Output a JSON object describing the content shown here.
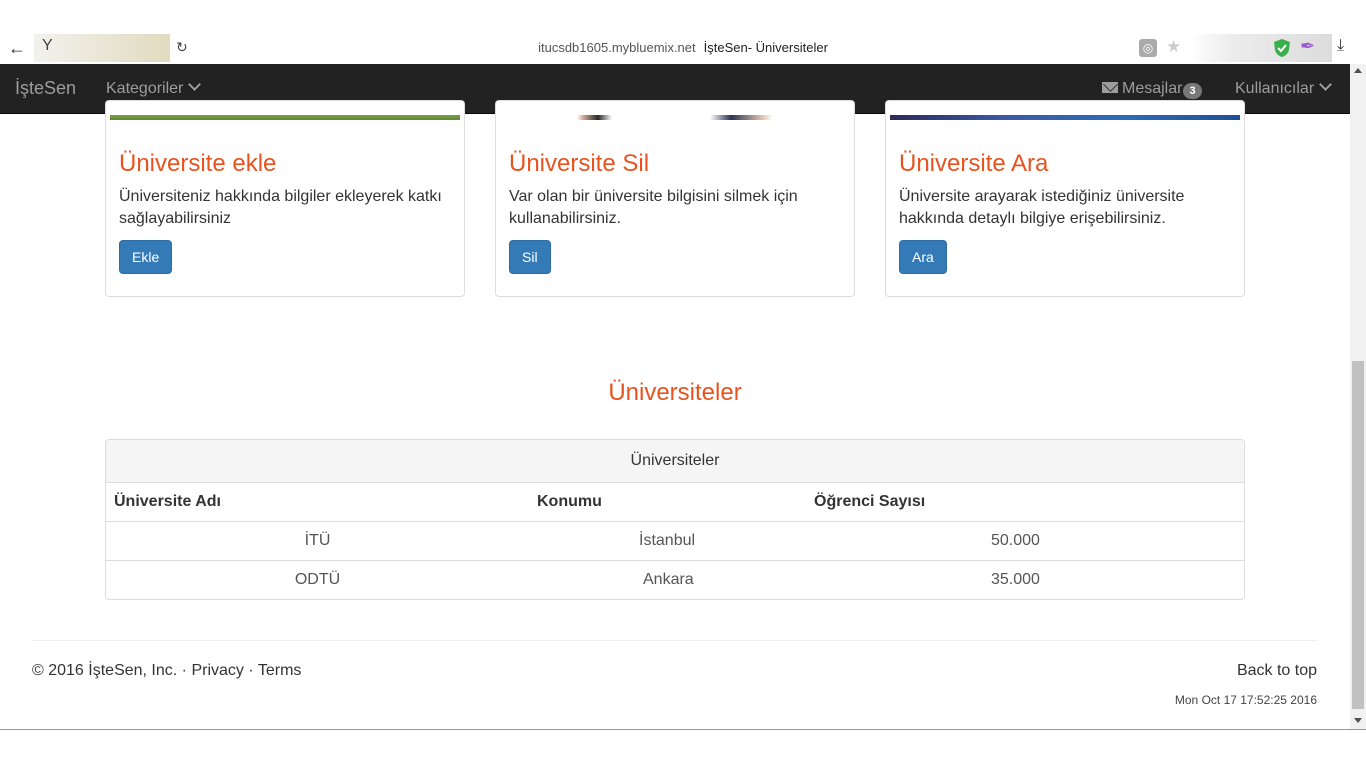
{
  "browser": {
    "omni_char": "Y",
    "url_host": "itucsdb1605.mybluemix.net",
    "page_title": "İşteSen- Üniversiteler"
  },
  "navbar": {
    "brand": "İşteSen",
    "categories": "Kategoriler",
    "messages": "Mesajlar",
    "messages_count": "3",
    "users": "Kullanıcılar"
  },
  "cards": [
    {
      "title": "Üniversite ekle",
      "text": "Üniversiteniz hakkında bilgiler ekleyerek katkı sağlayabilirsiniz",
      "button": "Ekle"
    },
    {
      "title": "Üniversite Sil",
      "text": "Var olan bir üniversite bilgisini silmek için kullanabilirsiniz.",
      "button": "Sil"
    },
    {
      "title": "Üniversite Ara",
      "text": "Üniversite arayarak istediğiniz üniversite hakkında detaylı bilgiye erişebilirsiniz.",
      "button": "Ara"
    }
  ],
  "section_title": "Üniversiteler",
  "table": {
    "heading": "Üniversiteler",
    "columns": [
      "Üniversite Adı",
      "Konumu",
      "Öğrenci Sayısı"
    ],
    "rows": [
      [
        "İTÜ",
        "İstanbul",
        "50.000"
      ],
      [
        "ODTÜ",
        "Ankara",
        "35.000"
      ]
    ]
  },
  "footer": {
    "copyright": "© 2016 İşteSen, Inc.",
    "sep": "·",
    "privacy": "Privacy",
    "terms": "Terms",
    "back_to_top": "Back to top",
    "timestamp": "Mon Oct 17 17:52:25 2016"
  },
  "colors": {
    "accent": "#e8531f",
    "button": "#337ab7",
    "navbar": "#222222"
  }
}
